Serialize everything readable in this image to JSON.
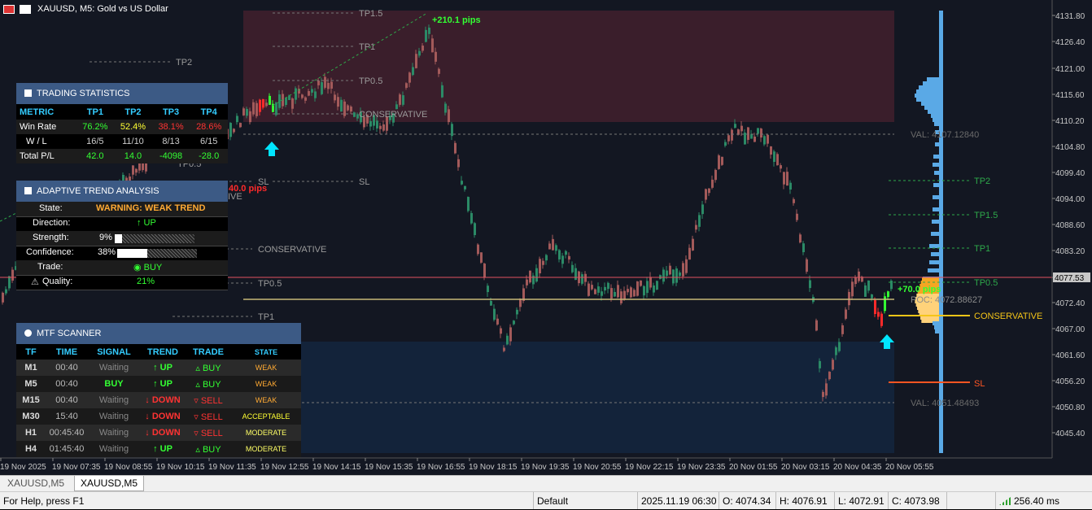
{
  "window": {
    "title": "XAUUSD, M5:  Gold vs US Dollar"
  },
  "colors": {
    "bg": "#131722",
    "bull": "#2b8a66",
    "bear": "#a35a5a",
    "pocBand": "#f5a623",
    "profileBar": "#5aa9e6",
    "pink": "#3a1e2b",
    "navy": "#13233a",
    "red": "#ff2a2a",
    "cyan": "#00e5ff"
  },
  "price_axis": {
    "labels": [
      "4131.80",
      "4126.40",
      "4121.00",
      "4115.60",
      "4110.20",
      "4104.80",
      "4099.40",
      "4094.00",
      "4088.60",
      "4083.20",
      "4077.53",
      "4072.40",
      "4067.00",
      "4061.60",
      "4056.20",
      "4050.80",
      "4045.40"
    ]
  },
  "time_axis": {
    "labels": [
      "19 Nov 2025",
      "19 Nov 07:35",
      "19 Nov 08:55",
      "19 Nov 10:15",
      "19 Nov 11:35",
      "19 Nov 12:55",
      "19 Nov 14:15",
      "19 Nov 15:35",
      "19 Nov 16:55",
      "19 Nov 18:15",
      "19 Nov 19:35",
      "19 Nov 20:55",
      "19 Nov 22:15",
      "19 Nov 23:35",
      "20 Nov 01:55",
      "20 Nov 03:15",
      "20 Nov 04:35",
      "20 Nov 05:55"
    ]
  },
  "levels": {
    "tp2_left": "TP2",
    "tp15": "TP1.5",
    "tp1": "TP1",
    "tp05": "TP0.5",
    "conservative": "CONSERVATIVE",
    "sl": "SL",
    "sl_left": "SL",
    "conservative_left": "CONSERVATIVE",
    "tp05_left": "TP0.5",
    "tp1_left": "TP1",
    "tp05_hidden": "TP0.5",
    "ive": "IVE",
    "pips_up": "+210.1 pips",
    "pips_down": "40.0 pips",
    "pips_right": "+70.0 pips",
    "val_top": "VAL: 4107.12840",
    "poc": "POC: 4072.88627",
    "val_bottom": "VAL: 4051.48493",
    "right_tp2": "TP2",
    "right_tp15": "TP1.5",
    "right_tp1": "TP1",
    "right_tp05": "TP0.5",
    "right_conservative": "CONSERVATIVE",
    "right_sl": "SL"
  },
  "trading_stats": {
    "title": "TRADING STATISTICS",
    "headers": [
      "METRIC",
      "TP1",
      "TP2",
      "TP3",
      "TP4"
    ],
    "rows": [
      {
        "label": "Win Rate",
        "cells": [
          "76.2%",
          "52.4%",
          "38.1%",
          "28.6%"
        ],
        "colors": [
          "#33ff33",
          "#ffff33",
          "#ff3333",
          "#ff3333"
        ]
      },
      {
        "label": "W / L",
        "cells": [
          "16/5",
          "11/10",
          "8/13",
          "6/15"
        ],
        "colors": [
          "#cccccc",
          "#cccccc",
          "#cccccc",
          "#cccccc"
        ]
      },
      {
        "label": "Total P/L",
        "cells": [
          "42.0",
          "14.0",
          "-4098",
          "-28.0"
        ],
        "colors": [
          "#33ff33",
          "#33ff33",
          "#33ff33",
          "#33ff33"
        ]
      }
    ]
  },
  "trend": {
    "title": "ADAPTIVE TREND ANALYSIS",
    "state_label": "State:",
    "state_value": "WARNING: WEAK TREND",
    "direction_label": "Direction:",
    "direction_value": "↑ UP",
    "strength_label": "Strength:",
    "strength_value": "9%",
    "strength_fraction": 0.09,
    "confidence_label": "Confidence:",
    "confidence_value": "38%",
    "confidence_fraction": 0.38,
    "trade_label": "Trade:",
    "trade_value": "◉ BUY",
    "quality_label": "Quality:",
    "quality_value": "21%"
  },
  "mtf": {
    "title": "MTF SCANNER",
    "headers": [
      "TF",
      "TIME",
      "SIGNAL",
      "TREND",
      "TRADE",
      "STATE"
    ],
    "rows": [
      {
        "tf": "M1",
        "time": "00:40",
        "signal": "Waiting",
        "trend": "↑ UP",
        "trade": "▵ BUY",
        "state": "WEAK",
        "sig_c": "#888888",
        "trend_c": "#33ff33",
        "trade_c": "#33ff33",
        "state_c": "#ffaa33"
      },
      {
        "tf": "M5",
        "time": "00:40",
        "signal": "BUY",
        "trend": "↑ UP",
        "trade": "▵ BUY",
        "state": "WEAK",
        "sig_c": "#33ff33",
        "trend_c": "#33ff33",
        "trade_c": "#33ff33",
        "state_c": "#ffaa33"
      },
      {
        "tf": "M15",
        "time": "00:40",
        "signal": "Waiting",
        "trend": "↓ DOWN",
        "trade": "▿ SELL",
        "state": "WEAK",
        "sig_c": "#888888",
        "trend_c": "#ff3333",
        "trade_c": "#ff3333",
        "state_c": "#ffaa33"
      },
      {
        "tf": "M30",
        "time": "15:40",
        "signal": "Waiting",
        "trend": "↓ DOWN",
        "trade": "▿ SELL",
        "state": "ACCEPTABLE",
        "sig_c": "#888888",
        "trend_c": "#ff3333",
        "trade_c": "#ff3333",
        "state_c": "#ffff33"
      },
      {
        "tf": "H1",
        "time": "00:45:40",
        "signal": "Waiting",
        "trend": "↓ DOWN",
        "trade": "▿ SELL",
        "state": "MODERATE",
        "sig_c": "#888888",
        "trend_c": "#ff3333",
        "trade_c": "#ff3333",
        "state_c": "#ffff66"
      },
      {
        "tf": "H4",
        "time": "01:45:40",
        "signal": "Waiting",
        "trend": "↑ UP",
        "trade": "▵ BUY",
        "state": "MODERATE",
        "sig_c": "#888888",
        "trend_c": "#33ff33",
        "trade_c": "#33ff33",
        "state_c": "#ffff66"
      }
    ]
  },
  "tabs": [
    "XAUUSD,M5",
    "XAUUSD,M5"
  ],
  "status": {
    "help": "For Help, press F1",
    "profile": "Default",
    "datetime": "2025.11.19 06:30",
    "open": "O: 4074.34",
    "high": "H: 4076.91",
    "low": "L: 4072.91",
    "close": "C: 4073.98",
    "ping": "256.40 ms"
  }
}
